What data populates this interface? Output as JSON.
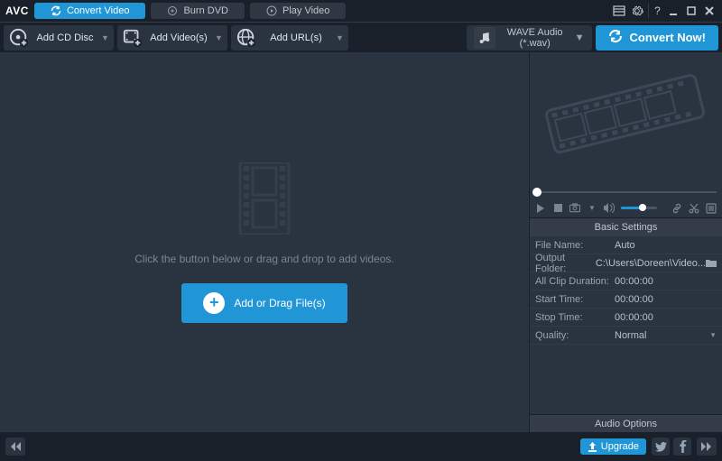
{
  "app": {
    "name": "AVC"
  },
  "tabs": {
    "convert": "Convert Video",
    "burn": "Burn DVD",
    "play": "Play Video"
  },
  "toolbar": {
    "add_cd": "Add CD Disc",
    "add_video": "Add Video(s)",
    "add_url": "Add URL(s)"
  },
  "output": {
    "format": "WAVE Audio (*.wav)"
  },
  "convert_label": "Convert Now!",
  "drop": {
    "hint": "Click the button below or drag and drop to add videos.",
    "button": "Add or Drag File(s)"
  },
  "settings": {
    "heading": "Basic Settings",
    "rows": {
      "file_name": {
        "k": "File Name:",
        "v": "Auto"
      },
      "output_folder": {
        "k": "Output Folder:",
        "v": "C:\\Users\\Doreen\\Video..."
      },
      "duration": {
        "k": "All Clip Duration:",
        "v": "00:00:00"
      },
      "start": {
        "k": "Start Time:",
        "v": "00:00:00"
      },
      "stop": {
        "k": "Stop Time:",
        "v": "00:00:00"
      },
      "quality": {
        "k": "Quality:",
        "v": "Normal"
      }
    },
    "audio_options": "Audio Options"
  },
  "footer": {
    "upgrade": "Upgrade"
  }
}
